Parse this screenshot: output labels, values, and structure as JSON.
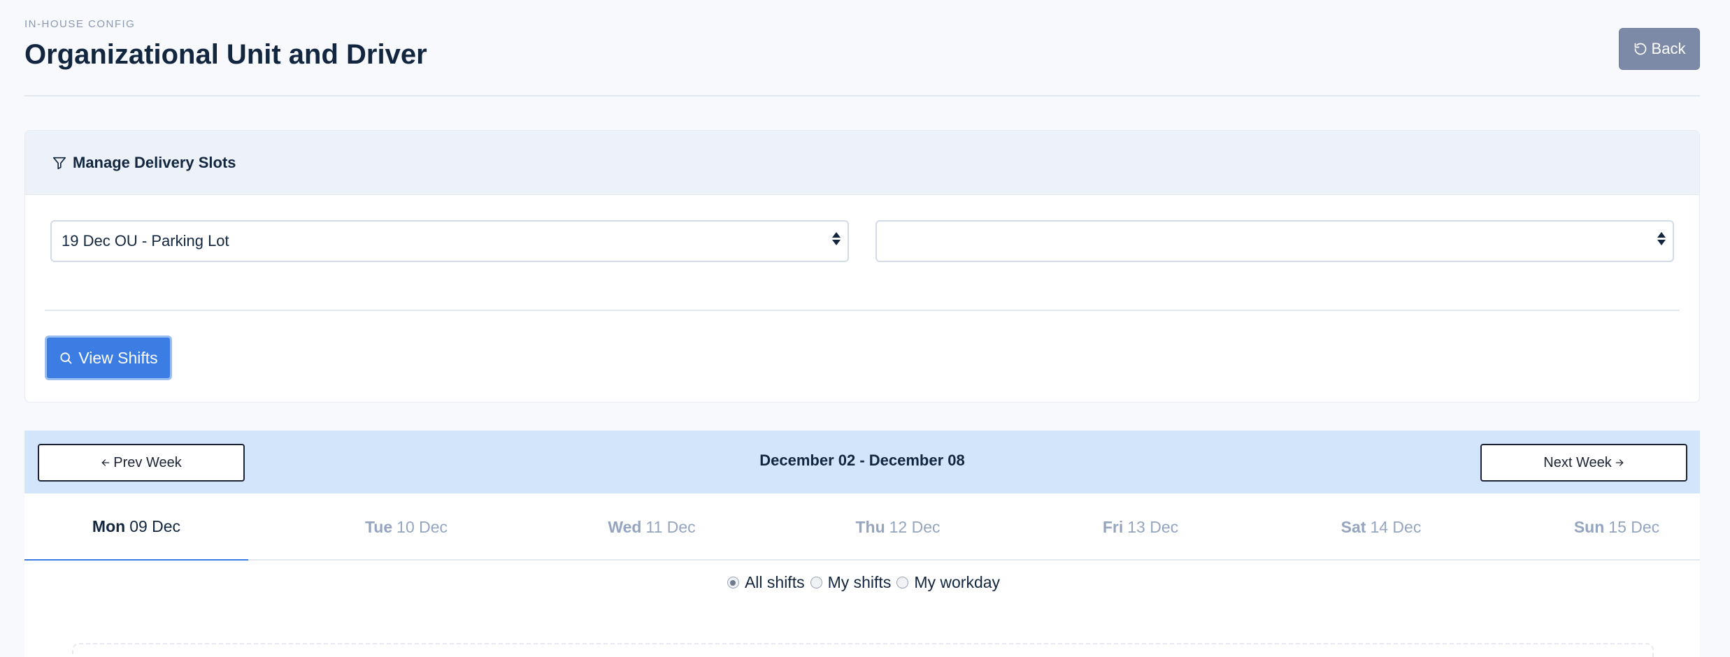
{
  "header": {
    "pretitle": "IN-HOUSE CONFIG",
    "title": "Organizational Unit and Driver",
    "back_label": "Back"
  },
  "filter_card": {
    "title": "Manage Delivery Slots",
    "select_unit": {
      "value": "19 Dec OU - Parking Lot"
    },
    "select_driver": {
      "value": ""
    },
    "view_button_label": "View Shifts"
  },
  "week": {
    "prev_label": "Prev Week",
    "next_label": "Next Week",
    "range": "December 02 - December 08"
  },
  "days": [
    {
      "dow": "Mon",
      "date": "09 Dec",
      "active": true
    },
    {
      "dow": "Tue",
      "date": "10 Dec",
      "active": false
    },
    {
      "dow": "Wed",
      "date": "11 Dec",
      "active": false
    },
    {
      "dow": "Thu",
      "date": "12 Dec",
      "active": false
    },
    {
      "dow": "Fri",
      "date": "13 Dec",
      "active": false
    },
    {
      "dow": "Sat",
      "date": "14 Dec",
      "active": false
    },
    {
      "dow": "Sun",
      "date": "15 Dec",
      "active": false
    }
  ],
  "shift_filter": {
    "options": [
      "All shifts",
      "My shifts",
      "My workday"
    ],
    "selected": "All shifts"
  },
  "colors": {
    "primary": "#3b7de3",
    "back_button": "#7c8aa8",
    "week_bar": "#d2e5fa"
  }
}
